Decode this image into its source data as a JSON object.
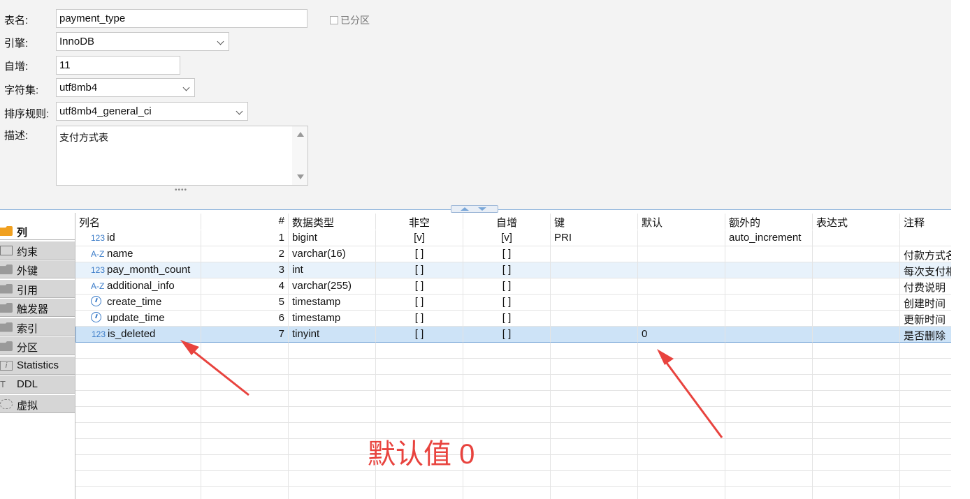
{
  "form": {
    "table_name_label": "表名:",
    "table_name_value": "payment_type",
    "partitioned_label": "已分区",
    "engine_label": "引擎:",
    "engine_value": "InnoDB",
    "auto_inc_label": "自增:",
    "auto_inc_value": "11",
    "charset_label": "字符集:",
    "charset_value": "utf8mb4",
    "collation_label": "排序规则:",
    "collation_value": "utf8mb4_general_ci",
    "desc_label": "描述:",
    "desc_value": "支付方式表"
  },
  "tabs": [
    {
      "label": "列",
      "icon": "columns-icon",
      "active": true
    },
    {
      "label": "约束",
      "icon": "constraints-icon"
    },
    {
      "label": "外键",
      "icon": "folder-icon"
    },
    {
      "label": "引用",
      "icon": "folder-icon"
    },
    {
      "label": "触发器",
      "icon": "folder-icon"
    },
    {
      "label": "索引",
      "icon": "folder-icon"
    },
    {
      "label": "分区",
      "icon": "folder-icon"
    },
    {
      "label": "Statistics",
      "icon": "info-icon"
    },
    {
      "label": "DDL",
      "icon": "ddl-icon"
    },
    {
      "label": "虚拟",
      "icon": "virtual-icon"
    }
  ],
  "grid": {
    "headers": [
      "列名",
      "#",
      "数据类型",
      "非空",
      "自增",
      "键",
      "默认",
      "额外的",
      "表达式",
      "注释"
    ],
    "rows": [
      {
        "icon": "numeric-icon",
        "type_glyph": "123",
        "name": "id",
        "num": "1",
        "type": "bigint",
        "not_null": "[v]",
        "auto_inc": "[v]",
        "key": "PRI",
        "default": "",
        "extra": "auto_increment",
        "expr": "",
        "comment": ""
      },
      {
        "icon": "text-icon",
        "type_glyph": "A-Z",
        "name": "name",
        "num": "2",
        "type": "varchar(16)",
        "not_null": "[ ]",
        "auto_inc": "[ ]",
        "key": "",
        "default": "",
        "extra": "",
        "expr": "",
        "comment": "付款方式名"
      },
      {
        "icon": "numeric-icon",
        "type_glyph": "123",
        "name": "pay_month_count",
        "num": "3",
        "type": "int",
        "not_null": "[ ]",
        "auto_inc": "[ ]",
        "key": "",
        "default": "",
        "extra": "",
        "expr": "",
        "comment": "每次支付相"
      },
      {
        "icon": "text-icon",
        "type_glyph": "A-Z",
        "name": "additional_info",
        "num": "4",
        "type": "varchar(255)",
        "not_null": "[ ]",
        "auto_inc": "[ ]",
        "key": "",
        "default": "",
        "extra": "",
        "expr": "",
        "comment": "付费说明"
      },
      {
        "icon": "clock-icon",
        "type_glyph": "",
        "name": "create_time",
        "num": "5",
        "type": "timestamp",
        "not_null": "[ ]",
        "auto_inc": "[ ]",
        "key": "",
        "default": "",
        "extra": "",
        "expr": "",
        "comment": "创建时间"
      },
      {
        "icon": "clock-icon",
        "type_glyph": "",
        "name": "update_time",
        "num": "6",
        "type": "timestamp",
        "not_null": "[ ]",
        "auto_inc": "[ ]",
        "key": "",
        "default": "",
        "extra": "",
        "expr": "",
        "comment": "更新时间"
      },
      {
        "icon": "numeric-icon",
        "type_glyph": "123",
        "name": "is_deleted",
        "num": "7",
        "type": "tinyint",
        "not_null": "[ ]",
        "auto_inc": "[ ]",
        "key": "",
        "default": "0",
        "extra": "",
        "expr": "",
        "comment": "是否删除"
      }
    ]
  },
  "annotation": {
    "text": "默认值 0",
    "color": "#e8433e"
  },
  "colors": {
    "selection": "#cde3f7",
    "accent": "#3a7bc8",
    "splitter": "#7aa7d8"
  }
}
